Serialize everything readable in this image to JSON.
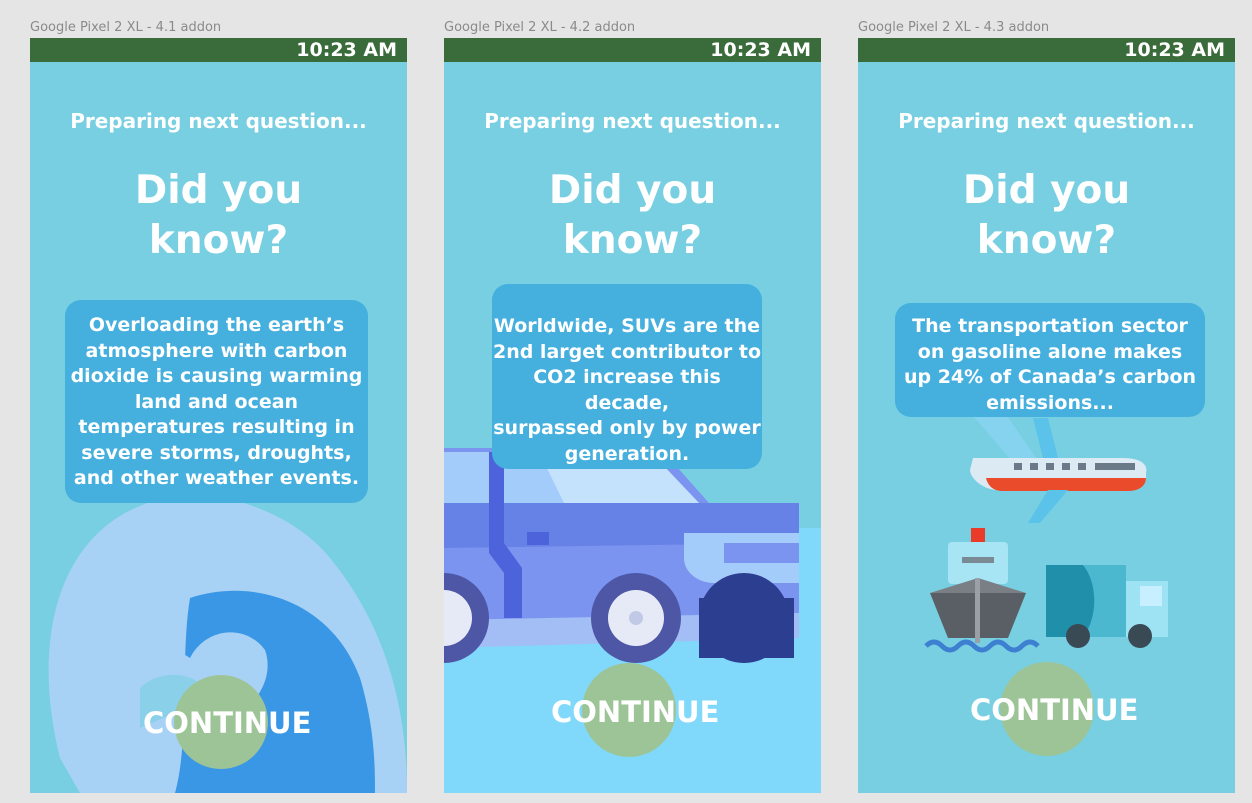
{
  "frames": [
    {
      "label": "Google Pixel 2 XL - 4.1 addon",
      "time": "10:23 AM",
      "preparing": "Preparing next question...",
      "heading_line1": "Did you",
      "heading_line2": "know?",
      "fact_lines": [
        "Overloading the earth’s",
        "atmosphere with carbon",
        "dioxide is causing warming",
        "land and ocean",
        "temperatures resulting in",
        "severe storms, droughts,",
        "and other weather events."
      ],
      "button": "CONTINUE",
      "illustration": "wave"
    },
    {
      "label": "Google Pixel 2 XL - 4.2 addon",
      "time": "10:23 AM",
      "preparing": "Preparing next question...",
      "heading_line1": "Did you",
      "heading_line2": "know?",
      "fact_lines": [
        "Worldwide, SUVs are the",
        "2nd larget contributor to",
        "CO2 increase this decade,",
        "surpassed only by power",
        "generation."
      ],
      "button": "CONTINUE",
      "illustration": "suv"
    },
    {
      "label": "Google Pixel 2 XL - 4.3 addon",
      "time": "10:23 AM",
      "preparing": "Preparing next question...",
      "heading_line1": "Did you",
      "heading_line2": "know?",
      "fact_lines": [
        "The transportation sector",
        "on gasoline alone makes",
        "up 24% of Canada’s carbon",
        "emissions..."
      ],
      "button": "CONTINUE",
      "illustration": "airplane-ship-truck"
    }
  ],
  "colors": {
    "background": "#78cfe1",
    "status_bar": "#3a6b3a",
    "fact_box": "#45afde",
    "button": "#9dc497"
  }
}
